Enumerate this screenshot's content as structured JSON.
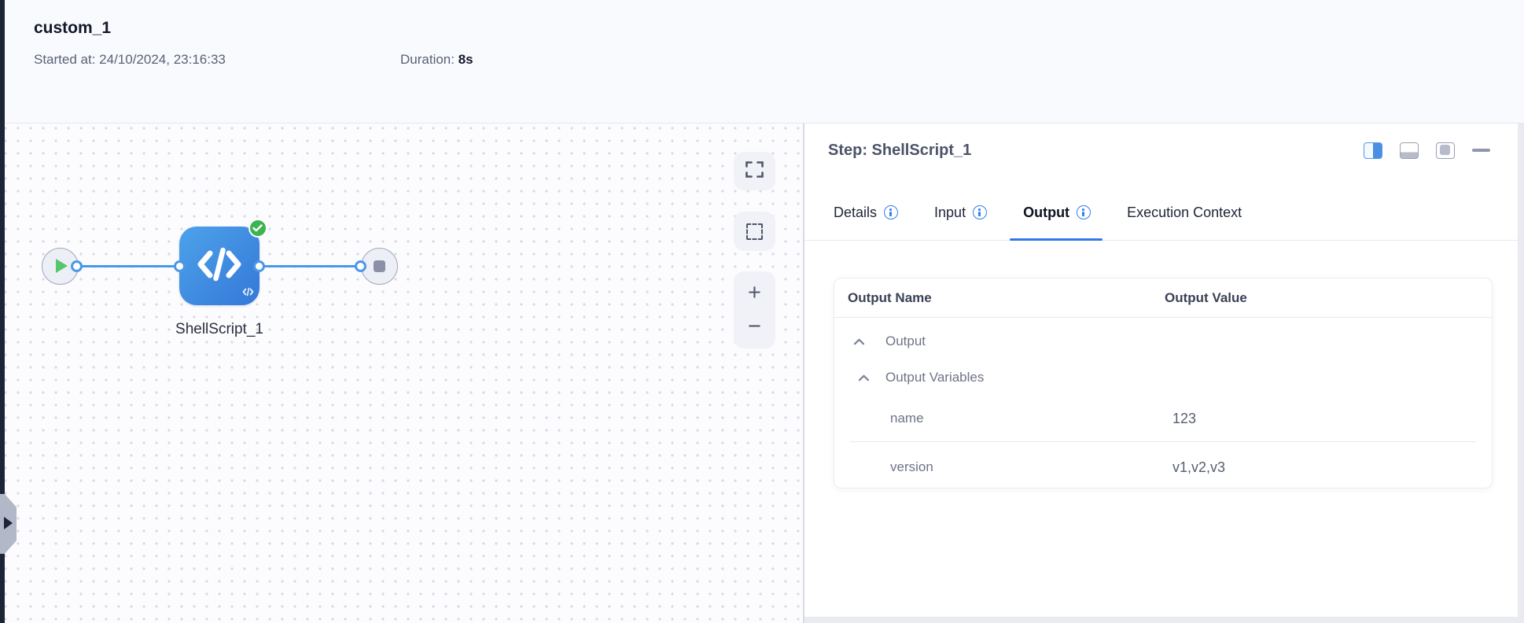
{
  "header": {
    "title": "custom_1",
    "started_label": "Started at:",
    "started_value": "24/10/2024, 23:16:33",
    "duration_label": "Duration:",
    "duration_value": "8s"
  },
  "canvas": {
    "node_label": "ShellScript_1",
    "zoom_in_label": "+",
    "zoom_out_label": "−"
  },
  "panel": {
    "step_title": "Step: ShellScript_1",
    "tabs": [
      {
        "label": "Details",
        "has_info": true,
        "active": false
      },
      {
        "label": "Input",
        "has_info": true,
        "active": false
      },
      {
        "label": "Output",
        "has_info": true,
        "active": true
      },
      {
        "label": "Execution Context",
        "has_info": false,
        "active": false
      }
    ],
    "table": {
      "col_name": "Output Name",
      "col_value": "Output Value",
      "groups": [
        {
          "label": "Output",
          "expanded": true
        },
        {
          "label": "Output Variables",
          "expanded": true
        }
      ],
      "rows": [
        {
          "name": "name",
          "value": "123"
        },
        {
          "name": "version",
          "value": "v1,v2,v3"
        }
      ]
    }
  },
  "icons": {
    "start": "play-icon",
    "end": "stop-icon",
    "node": "code-icon",
    "status": "check-circle-icon",
    "expand": "expand-icon",
    "marquee": "marquee-select-icon",
    "layout_split": "layout-split-vertical-icon",
    "layout_rows": "layout-split-horizontal-icon",
    "layout_panel": "layout-panel-icon",
    "minimize": "minimize-icon",
    "info": "info-icon",
    "drawer": "chevron-right-icon",
    "collapse_row": "chevron-up-icon"
  },
  "colors": {
    "accent_blue": "#3376e8",
    "edge_blue": "#4a98e8",
    "node_blue_start": "#4da2ea",
    "node_blue_end": "#3478d8",
    "success_green": "#3db44f",
    "play_green": "#57c46e",
    "navy": "#1d2438",
    "info_blue": "#2f80ed"
  }
}
